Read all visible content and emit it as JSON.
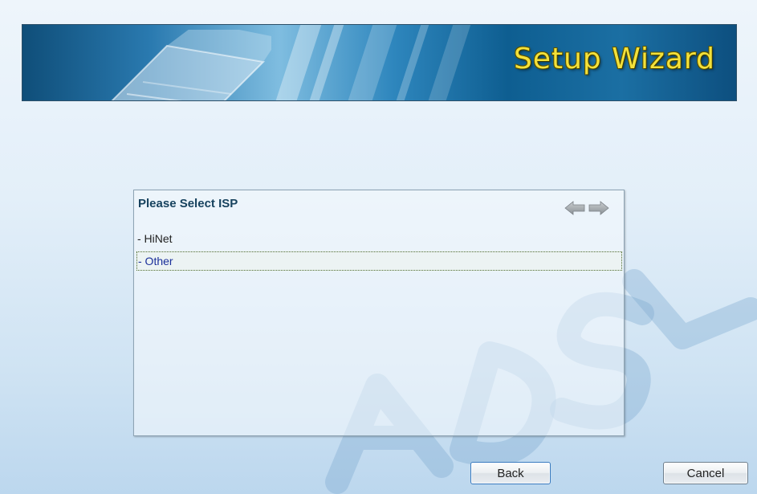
{
  "banner": {
    "title": "Setup Wizard"
  },
  "panel": {
    "title": "Please Select ISP",
    "nav": {
      "back_icon": "arrow-left-icon",
      "forward_icon": "arrow-right-icon"
    },
    "isp_options": [
      {
        "label": "- HiNet",
        "selected": false
      },
      {
        "label": "- Other",
        "selected": true
      }
    ]
  },
  "buttons": {
    "back_label": "Back",
    "cancel_label": "Cancel"
  },
  "colors": {
    "title_yellow": "#f4e13a",
    "panel_title": "#17425e",
    "selected_text": "#1a2f9a"
  }
}
